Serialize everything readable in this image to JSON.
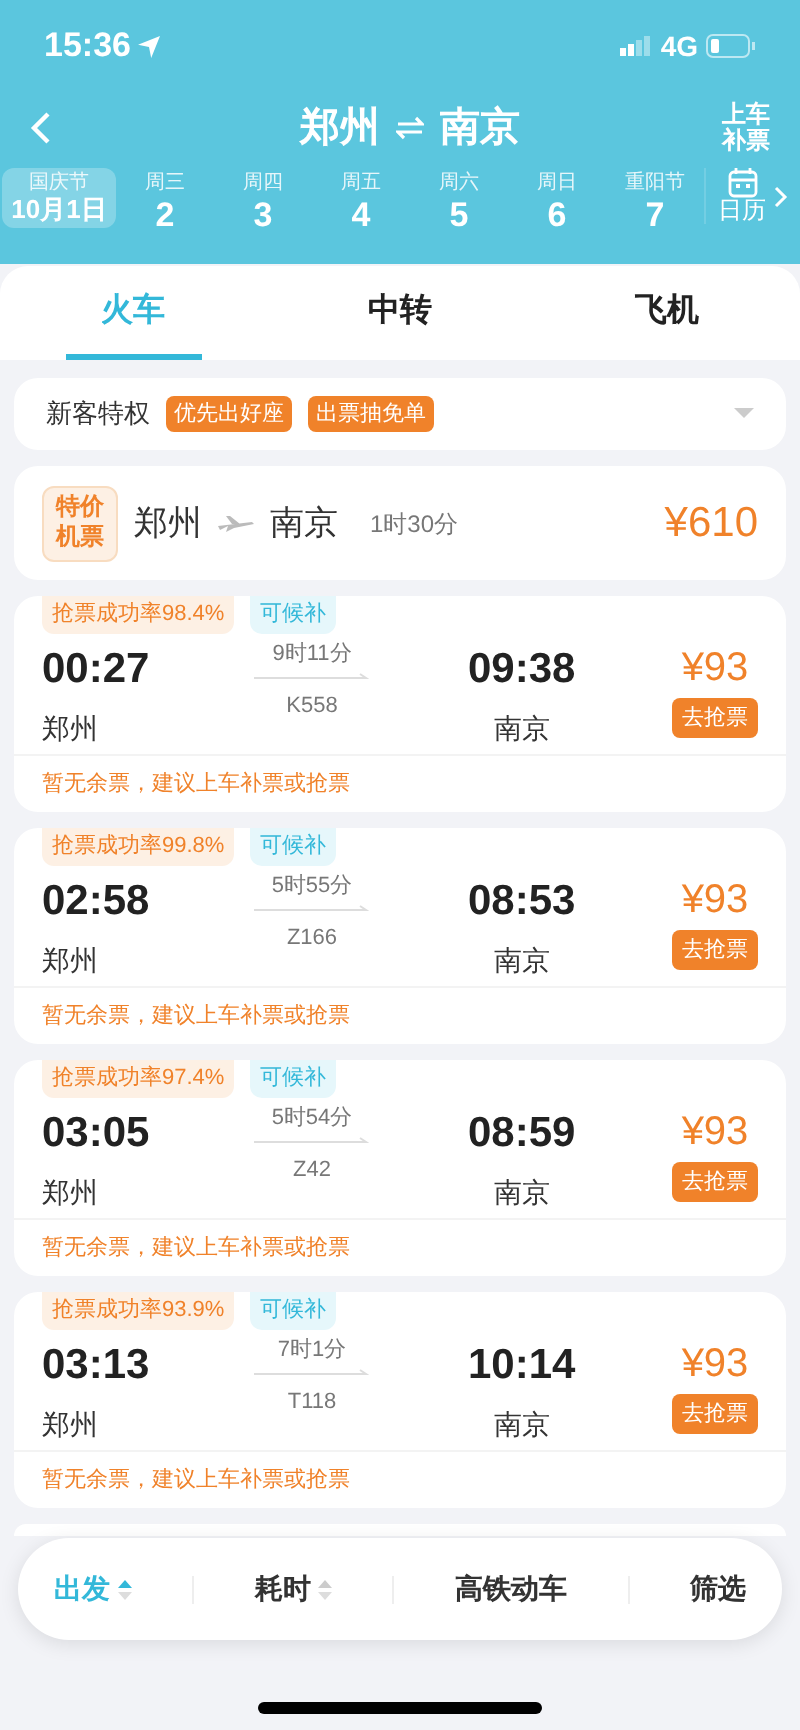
{
  "status_bar": {
    "time": "15:36",
    "network": "4G"
  },
  "header": {
    "from": "郑州",
    "to": "南京",
    "right_button": "上车补票"
  },
  "dates": [
    {
      "label": "国庆节",
      "day": "10月1日",
      "selected": true
    },
    {
      "label": "周三",
      "day": "2",
      "selected": false
    },
    {
      "label": "周四",
      "day": "3",
      "selected": false
    },
    {
      "label": "周五",
      "day": "4",
      "selected": false
    },
    {
      "label": "周六",
      "day": "5",
      "selected": false
    },
    {
      "label": "周日",
      "day": "6",
      "selected": false
    },
    {
      "label": "重阳节",
      "day": "7",
      "selected": false
    }
  ],
  "calendar": {
    "label": "日历"
  },
  "tabs": [
    {
      "label": "火车",
      "selected": true
    },
    {
      "label": "中转",
      "selected": false
    },
    {
      "label": "飞机",
      "selected": false
    }
  ],
  "promo": {
    "label": "新客特权",
    "tags": [
      "优先出好座",
      "出票抽免单"
    ]
  },
  "flight": {
    "badge": "特价机票",
    "from": "郑州",
    "to": "南京",
    "duration": "1时30分",
    "price": "¥610"
  },
  "trains": [
    {
      "rate": "抢票成功率98.4%",
      "tag": "可候补",
      "depart": "00:27",
      "duration": "9时11分",
      "arrive": "09:38",
      "from": "郑州",
      "number": "K558",
      "to": "南京",
      "price": "¥93",
      "button": "去抢票",
      "notice": "暂无余票，建议上车补票或抢票"
    },
    {
      "rate": "抢票成功率99.8%",
      "tag": "可候补",
      "depart": "02:58",
      "duration": "5时55分",
      "arrive": "08:53",
      "from": "郑州",
      "number": "Z166",
      "to": "南京",
      "price": "¥93",
      "button": "去抢票",
      "notice": "暂无余票，建议上车补票或抢票"
    },
    {
      "rate": "抢票成功率97.4%",
      "tag": "可候补",
      "depart": "03:05",
      "duration": "5时54分",
      "arrive": "08:59",
      "from": "郑州",
      "number": "Z42",
      "to": "南京",
      "price": "¥93",
      "button": "去抢票",
      "notice": "暂无余票，建议上车补票或抢票"
    },
    {
      "rate": "抢票成功率93.9%",
      "tag": "可候补",
      "depart": "03:13",
      "duration": "7时1分",
      "arrive": "10:14",
      "from": "郑州",
      "number": "T118",
      "to": "南京",
      "price": "¥93",
      "button": "去抢票",
      "notice": "暂无余票，建议上车补票或抢票"
    }
  ],
  "sort_bar": [
    {
      "label": "出发",
      "kind": "sort",
      "selected": true
    },
    {
      "label": "耗时",
      "kind": "sort",
      "selected": false
    },
    {
      "label": "高铁动车",
      "kind": "plain",
      "selected": false
    },
    {
      "label": "筛选",
      "kind": "plain",
      "selected": false
    }
  ]
}
